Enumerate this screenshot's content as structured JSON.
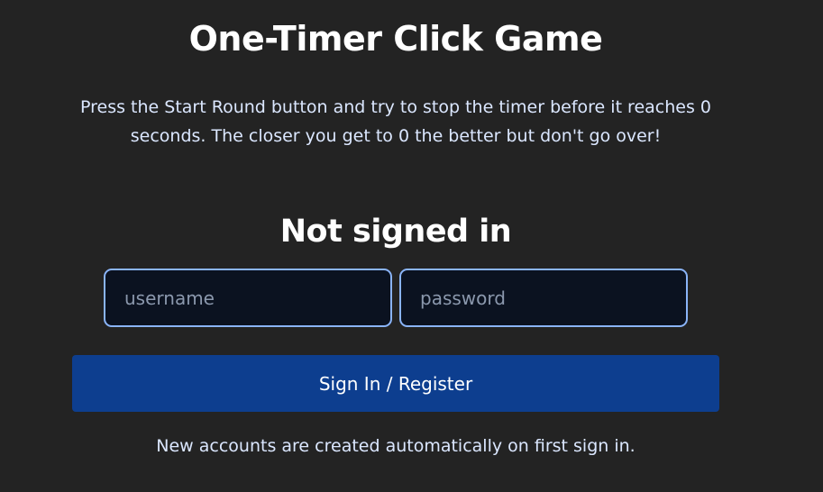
{
  "title": "One-Timer Click Game",
  "instructions": "Press the Start Round button and try to stop the timer before it reaches 0 seconds. The closer you get to 0 the better but don't go over!",
  "auth": {
    "status": "Not signed in",
    "username_placeholder": "username",
    "password_placeholder": "password",
    "submit_label": "Sign In / Register",
    "note": "New accounts are created automatically on first sign in."
  },
  "colors": {
    "background": "#232323",
    "text": "#ffffff",
    "muted_text": "#dbe7ff",
    "input_background": "#0b1220",
    "input_border": "#8ab4f8",
    "button_background": "#0d3e8f"
  }
}
